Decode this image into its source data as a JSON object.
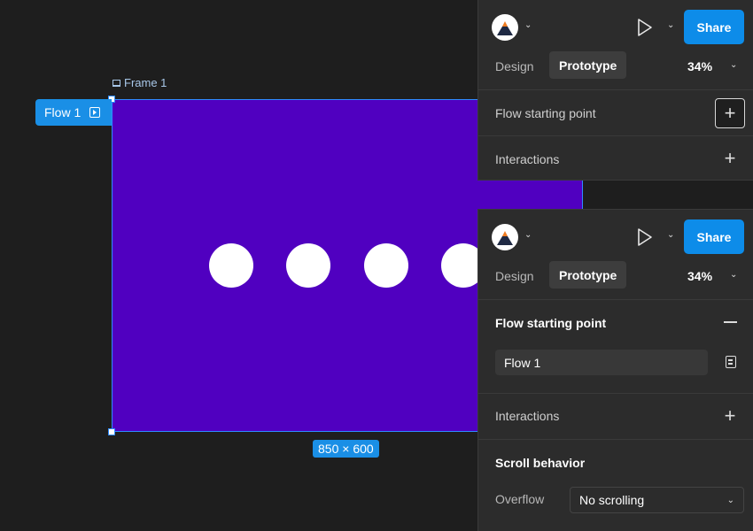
{
  "canvas": {
    "frame_label": "Frame 1",
    "flow_tag": "Flow 1",
    "size_badge": "850 × 600",
    "frame_color": "#5000c0",
    "selection_color": "#2f8bff"
  },
  "panel_top": {
    "share_label": "Share",
    "tabs": {
      "design": "Design",
      "prototype": "Prototype"
    },
    "zoom": "34%",
    "flow_section": {
      "title": "Flow starting point"
    },
    "interactions_section": {
      "title": "Interactions"
    }
  },
  "panel_bottom": {
    "share_label": "Share",
    "tabs": {
      "design": "Design",
      "prototype": "Prototype"
    },
    "zoom": "34%",
    "flow_section": {
      "title": "Flow starting point",
      "flow_name": "Flow 1"
    },
    "interactions_section": {
      "title": "Interactions"
    },
    "scroll_section": {
      "title": "Scroll behavior",
      "overflow_label": "Overflow",
      "overflow_value": "No scrolling"
    }
  },
  "icons": {
    "plus": "+",
    "chevron": "⌄"
  },
  "colors": {
    "accent": "#0d8ce9",
    "panel_bg": "#2c2c2c",
    "canvas_bg": "#1e1e1e"
  }
}
